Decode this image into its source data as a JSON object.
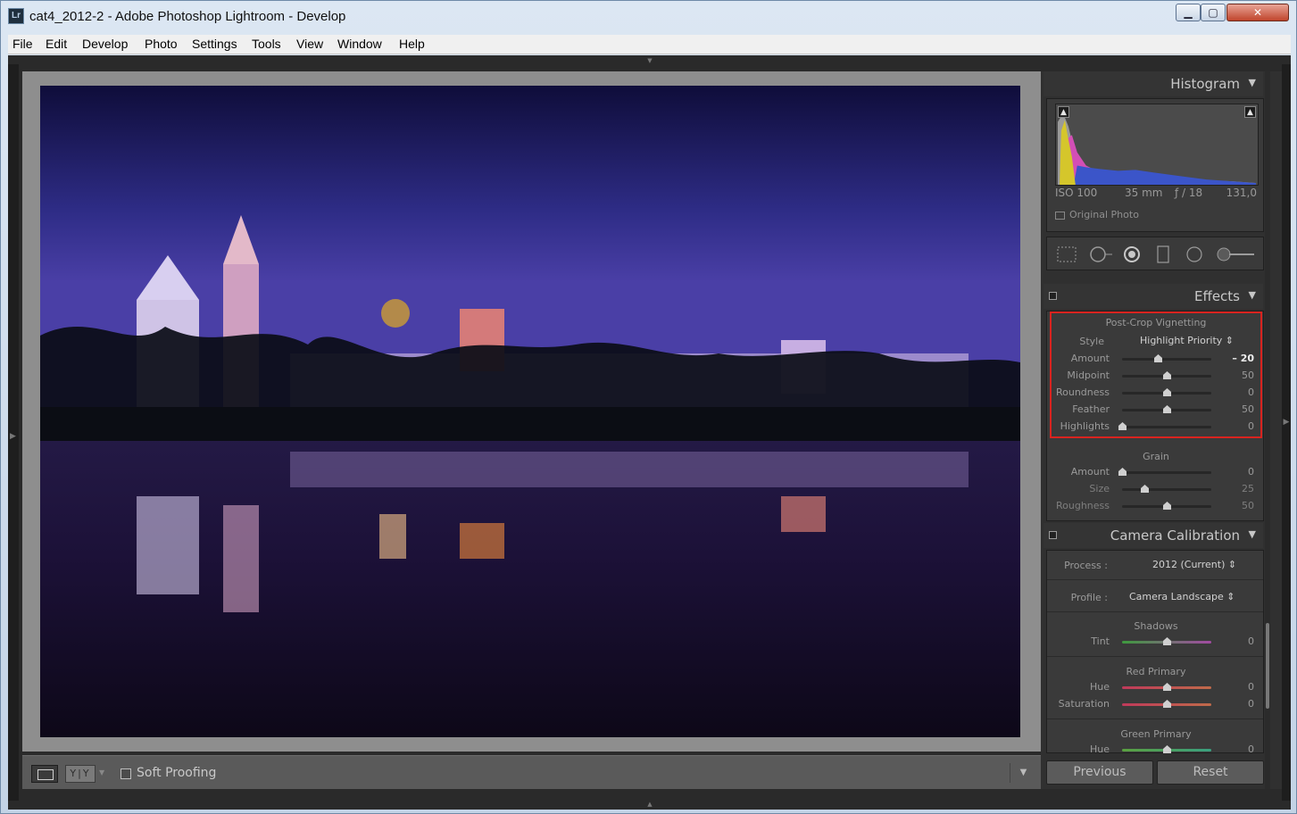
{
  "window": {
    "app_icon": "Lr",
    "title": "cat4_2012-2 - Adobe Photoshop Lightroom - Develop",
    "minimize": "▁",
    "maximize": "▢",
    "close": "✕"
  },
  "menu": [
    "File",
    "Edit",
    "Develop",
    "Photo",
    "Settings",
    "Tools",
    "View",
    "Window",
    "Help"
  ],
  "toolbar": {
    "view_yy": "Y|Y",
    "soft_proofing_label": "Soft Proofing",
    "soft_proofing_checked": false
  },
  "histogram": {
    "title": "Histogram",
    "iso": "ISO 100",
    "focal_length": "35 mm",
    "aperture": "ƒ / 18",
    "shutter": "131,0",
    "original_photo_label": "Original Photo"
  },
  "effects": {
    "title": "Effects",
    "vignette": {
      "title": "Post-Crop Vignetting",
      "style_label": "Style",
      "style_value": "Highlight Priority ⇕",
      "sliders": [
        {
          "label": "Amount",
          "value": "– 20",
          "position": 0.4
        },
        {
          "label": "Midpoint",
          "value": "50",
          "position": 0.5
        },
        {
          "label": "Roundness",
          "value": "0",
          "position": 0.5
        },
        {
          "label": "Feather",
          "value": "50",
          "position": 0.5
        },
        {
          "label": "Highlights",
          "value": "0",
          "position": 0.0
        }
      ]
    },
    "grain": {
      "title": "Grain",
      "sliders": [
        {
          "label": "Amount",
          "value": "0",
          "position": 0.0
        },
        {
          "label": "Size",
          "value": "25",
          "position": 0.25
        },
        {
          "label": "Roughness",
          "value": "50",
          "position": 0.5
        }
      ]
    }
  },
  "camera_calibration": {
    "title": "Camera Calibration",
    "process_label": "Process :",
    "process_value": "2012 (Current) ⇕",
    "profile_label": "Profile :",
    "profile_value": "Camera Landscape ⇕",
    "shadows": {
      "title": "Shadows",
      "sliders": [
        {
          "label": "Tint",
          "value": "0",
          "position": 0.5
        }
      ]
    },
    "red_primary": {
      "title": "Red Primary",
      "sliders": [
        {
          "label": "Hue",
          "value": "0",
          "position": 0.5
        },
        {
          "label": "Saturation",
          "value": "0",
          "position": 0.5
        }
      ]
    },
    "green_primary": {
      "title": "Green Primary",
      "sliders": [
        {
          "label": "Hue",
          "value": "0",
          "position": 0.5
        }
      ]
    }
  },
  "buttons": {
    "previous": "Previous",
    "reset": "Reset"
  },
  "icons": {
    "triangle": "▼",
    "up_arrow_small": "▲",
    "panel_left": "◀",
    "panel_right": "▶",
    "chevron": "▾"
  }
}
